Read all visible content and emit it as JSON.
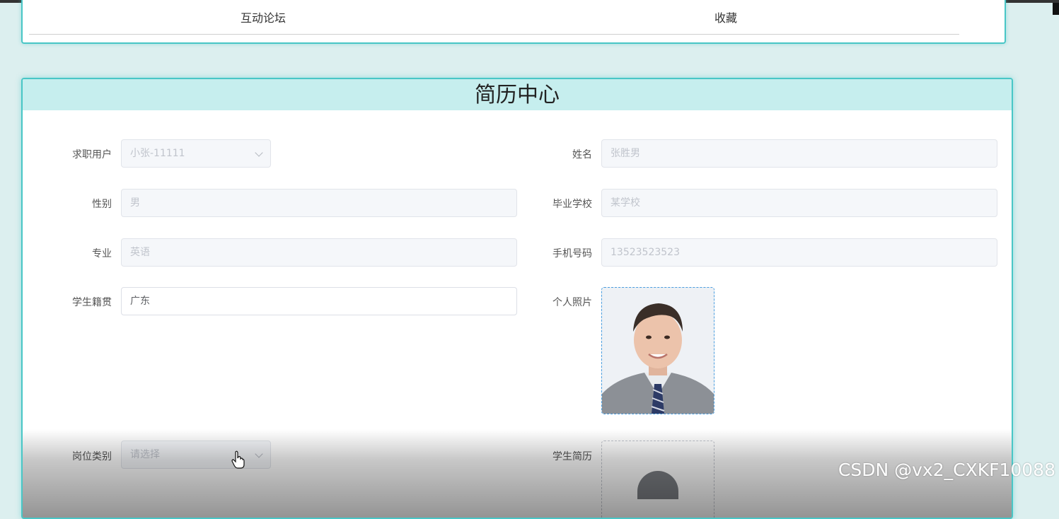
{
  "nav": {
    "items": [
      {
        "label": "互动论坛"
      },
      {
        "label": "收藏"
      }
    ]
  },
  "page": {
    "title": "简历中心"
  },
  "form": {
    "job_user": {
      "label": "求职用户",
      "value": "小张-11111"
    },
    "name": {
      "label": "姓名",
      "value": "张胜男"
    },
    "gender": {
      "label": "性别",
      "value": "男"
    },
    "school": {
      "label": "毕业学校",
      "value": "某学校"
    },
    "major": {
      "label": "专业",
      "value": "英语"
    },
    "phone": {
      "label": "手机号码",
      "value": "13523523523"
    },
    "hometown": {
      "label": "学生籍贯",
      "value": "广东"
    },
    "photo": {
      "label": "个人照片"
    },
    "position_type": {
      "label": "岗位类别",
      "placeholder": "请选择"
    },
    "resume": {
      "label": "学生简历"
    }
  },
  "icons": {
    "dropdown": "chevron-down-icon",
    "upload": "cloud-upload-icon",
    "cursor": "hand-cursor-icon"
  },
  "watermark": "CSDN @vx2_CXKF10088",
  "colors": {
    "accent": "#49c6c6",
    "header_bg": "#c6eeee",
    "page_bg": "#dcefef"
  }
}
